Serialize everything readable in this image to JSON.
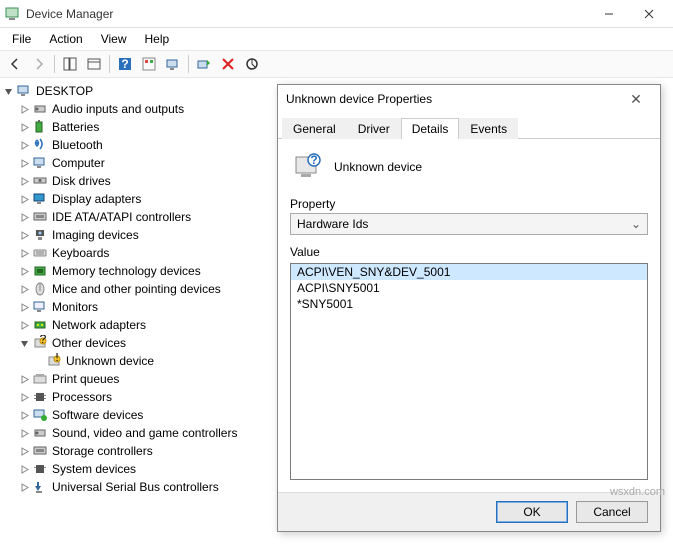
{
  "window": {
    "title": "Device Manager"
  },
  "menu": {
    "file": "File",
    "action": "Action",
    "view": "View",
    "help": "Help"
  },
  "tree": {
    "root": "DESKTOP",
    "items": [
      "Audio inputs and outputs",
      "Batteries",
      "Bluetooth",
      "Computer",
      "Disk drives",
      "Display adapters",
      "IDE ATA/ATAPI controllers",
      "Imaging devices",
      "Keyboards",
      "Memory technology devices",
      "Mice and other pointing devices",
      "Monitors",
      "Network adapters",
      "Other devices",
      "Print queues",
      "Processors",
      "Software devices",
      "Sound, video and game controllers",
      "Storage controllers",
      "System devices",
      "Universal Serial Bus controllers"
    ],
    "child": "Unknown device"
  },
  "dialog": {
    "title": "Unknown device Properties",
    "tabs": {
      "general": "General",
      "driver": "Driver",
      "details": "Details",
      "events": "Events"
    },
    "device_name": "Unknown device",
    "property_label": "Property",
    "property_value": "Hardware Ids",
    "value_label": "Value",
    "values": [
      "ACPI\\VEN_SNY&DEV_5001",
      "ACPI\\SNY5001",
      "*SNY5001"
    ],
    "ok": "OK",
    "cancel": "Cancel"
  },
  "watermark": "wsxdn.com"
}
